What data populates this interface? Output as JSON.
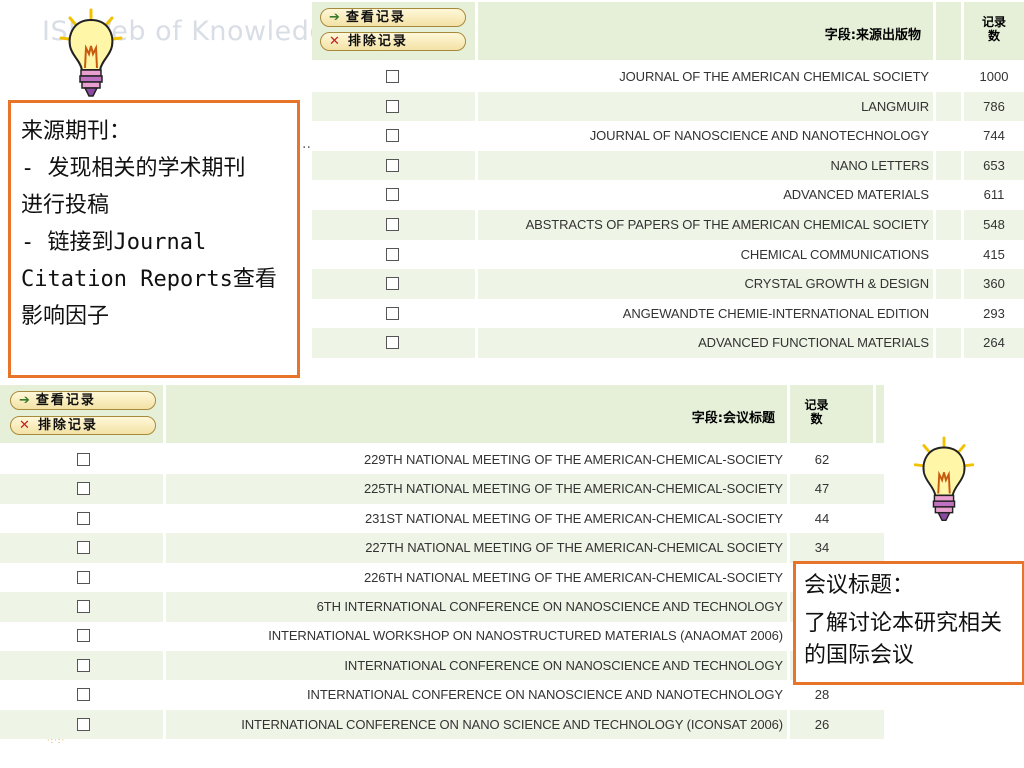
{
  "background_title": "ISI Web of Knowledge",
  "buttons": {
    "view_records": "查看记录",
    "exclude_records": "排除记录"
  },
  "journals_table": {
    "field_header": "字段:来源出版物",
    "count_header": "记录\n数",
    "rows": [
      {
        "name": "JOURNAL OF THE AMERICAN CHEMICAL SOCIETY",
        "count": "1000"
      },
      {
        "name": "LANGMUIR",
        "count": "786"
      },
      {
        "name": "JOURNAL OF NANOSCIENCE AND NANOTECHNOLOGY",
        "count": "744"
      },
      {
        "name": "NANO LETTERS",
        "count": "653"
      },
      {
        "name": "ADVANCED MATERIALS",
        "count": "611"
      },
      {
        "name": "ABSTRACTS OF PAPERS OF THE AMERICAN CHEMICAL SOCIETY",
        "count": "548"
      },
      {
        "name": "CHEMICAL COMMUNICATIONS",
        "count": "415"
      },
      {
        "name": "CRYSTAL GROWTH & DESIGN",
        "count": "360"
      },
      {
        "name": "ANGEWANDTE CHEMIE-INTERNATIONAL EDITION",
        "count": "293"
      },
      {
        "name": "ADVANCED FUNCTIONAL MATERIALS",
        "count": "264"
      }
    ]
  },
  "conference_table": {
    "field_header": "字段:会议标题",
    "count_header": "记录\n数",
    "rows": [
      {
        "name": "229TH NATIONAL MEETING OF THE AMERICAN-CHEMICAL-SOCIETY",
        "count": "62"
      },
      {
        "name": "225TH NATIONAL MEETING OF THE AMERICAN-CHEMICAL-SOCIETY",
        "count": "47"
      },
      {
        "name": "231ST NATIONAL MEETING OF THE AMERICAN-CHEMICAL-SOCIETY",
        "count": "44"
      },
      {
        "name": "227TH NATIONAL MEETING OF THE AMERICAN-CHEMICAL SOCIETY",
        "count": "34"
      },
      {
        "name": "226TH NATIONAL MEETING OF THE AMERICAN-CHEMICAL-SOCIETY",
        "count": ""
      },
      {
        "name": "6TH INTERNATIONAL CONFERENCE ON NANOSCIENCE AND TECHNOLOGY",
        "count": ""
      },
      {
        "name": "INTERNATIONAL WORKSHOP ON NANOSTRUCTURED MATERIALS (ANAOMAT 2006)",
        "count": ""
      },
      {
        "name": "INTERNATIONAL CONFERENCE ON NANOSCIENCE AND TECHNOLOGY",
        "count": ""
      },
      {
        "name": "INTERNATIONAL CONFERENCE ON NANOSCIENCE AND NANOTECHNOLOGY",
        "count": "28"
      },
      {
        "name": "INTERNATIONAL CONFERENCE ON NANO SCIENCE AND TECHNOLOGY (ICONSAT 2006)",
        "count": "26"
      }
    ]
  },
  "callout_journals": {
    "text": "来源期刊：\n- 发现相关的学术期刊\n进行投稿\n- 链接到Journal\nCitation Reports查看\n影响因子"
  },
  "callout_conferences": {
    "heading": "会议标题：",
    "text": "了解讨论本研究相关的国际会议"
  },
  "colors": {
    "header_bg": "#e6f0d8",
    "row_alt_bg": "#eef4e6",
    "callout_border": "#e8742a"
  },
  "icons": [
    "lightbulb-icon",
    "arrow-right-icon",
    "x-icon",
    "checkbox-icon"
  ]
}
